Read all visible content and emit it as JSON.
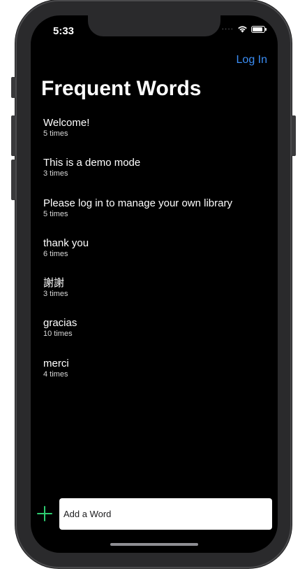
{
  "status_bar": {
    "time": "5:33",
    "signal_icon": "cellular-dots-icon",
    "wifi_icon": "wifi-icon",
    "battery_icon": "battery-icon"
  },
  "nav": {
    "login_label": "Log In",
    "title": "Frequent Words"
  },
  "words": [
    {
      "text": "Welcome!",
      "count": "5 times"
    },
    {
      "text": "This is a demo mode",
      "count": "3 times"
    },
    {
      "text": "Please log in to manage your own library",
      "count": "5 times"
    },
    {
      "text": "thank you",
      "count": "6 times"
    },
    {
      "text": "謝謝",
      "count": "3 times"
    },
    {
      "text": "gracias",
      "count": "10 times"
    },
    {
      "text": "merci",
      "count": "4 times"
    }
  ],
  "add_word": {
    "placeholder": "Add a Word",
    "value": "",
    "add_icon": "plus-icon"
  },
  "colors": {
    "accent": "#3b8ef5",
    "add_icon": "#2ecc71",
    "background": "#000000"
  }
}
